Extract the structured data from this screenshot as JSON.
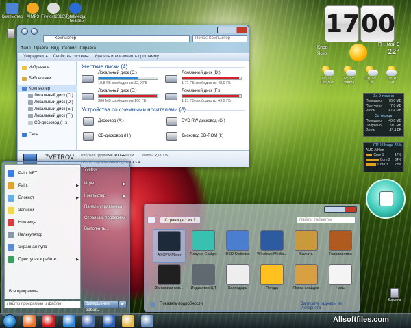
{
  "desktop_icons": [
    {
      "label": "Компьютер",
      "color": "#4d84d8"
    },
    {
      "label": "AIMP3",
      "color": "#f5a623"
    },
    {
      "label": "Firefox(2010)",
      "color": "#dddddd"
    },
    {
      "label": "TotalMedia Theatre5",
      "color": "#2b6bd6"
    }
  ],
  "explorer": {
    "address": "Компьютер",
    "search_placeholder": "Поиск: Компьютер",
    "menu": [
      "Файл",
      "Правка",
      "Вид",
      "Сервис",
      "Справка"
    ],
    "commands": [
      "Упорядочить",
      "Свойства системы",
      "Удалить или изменить программу"
    ],
    "nav": [
      {
        "label": "Избранное",
        "icon": "star-icon",
        "sub": false,
        "hl": false
      },
      {
        "label": "Библиотеки",
        "icon": "library-icon",
        "sub": false,
        "hl": false
      },
      {
        "label": "Компьютер",
        "icon": "computer-icon",
        "sub": false,
        "hl": true
      },
      {
        "label": "Локальный диск (C:)",
        "icon": "drive-icon",
        "sub": true,
        "hl": false
      },
      {
        "label": "Локальный диск (D:)",
        "icon": "drive-icon",
        "sub": true,
        "hl": false
      },
      {
        "label": "Локальный диск (E:)",
        "icon": "drive-icon",
        "sub": true,
        "hl": false
      },
      {
        "label": "Локальный диск (F:)",
        "icon": "drive-icon",
        "sub": true,
        "hl": false
      },
      {
        "label": "CD-дисковод (H:)",
        "icon": "cd-drive-icon",
        "sub": true,
        "hl": false
      },
      {
        "label": "Сеть",
        "icon": "network-icon",
        "sub": false,
        "hl": false
      }
    ],
    "group_hdd": "Жесткие диски (4)",
    "group_removable": "Устройства со съемными носителями (4)",
    "drives": [
      {
        "name": "Локальный диск (C:)",
        "free": "10,8 ГБ свободно из 32,9 ГБ",
        "used_fraction": 0.67,
        "color": "#2b88d8"
      },
      {
        "name": "Локальный диск (D:)",
        "free": "1,71 ГБ свободно из 48,9 ГБ",
        "used_fraction": 0.96,
        "color": "#d9202a"
      },
      {
        "name": "Локальный диск (E:)",
        "free": "306 МБ свободно из 100 ГБ",
        "used_fraction": 0.99,
        "color": "#d9202a"
      },
      {
        "name": "Локальный диск (F:)",
        "free": "1,21 ГБ свободно из 49,9 ГБ",
        "used_fraction": 0.97,
        "color": "#d9202a"
      }
    ],
    "removable": [
      "Дисковод (A:)",
      "DVD RW дисковод (G:)",
      "CD-дисковод (H:)",
      "Дисковод BD-ROM (I:)"
    ],
    "details": {
      "name": "7VETROV",
      "wg_label": "Рабочая группа:",
      "wg": "WORKGROUP",
      "mem_label": "Память:",
      "mem": "2,00 ГБ",
      "cpu_label": "Процессор:",
      "cpu": "AMD Athlon(tm) II X3 4..."
    }
  },
  "start_menu": {
    "programs": [
      {
        "label": "Paint.NET",
        "arrow": false,
        "color": "#3d7de0"
      },
      {
        "label": "Paint",
        "arrow": true,
        "color": "#e0a030"
      },
      {
        "label": "Блокнот",
        "arrow": true,
        "color": "#6ab0e8"
      },
      {
        "label": "Записки",
        "arrow": false,
        "color": "#f0d84a"
      },
      {
        "label": "Ножницы",
        "arrow": false,
        "color": "#d04040"
      },
      {
        "label": "Калькулятор",
        "arrow": false,
        "color": "#8899aa"
      },
      {
        "label": "Экранная лупа",
        "arrow": false,
        "color": "#5a8ad8"
      },
      {
        "label": "Приступая к работе",
        "arrow": true,
        "color": "#3aa060"
      }
    ],
    "all_programs": "Все программы",
    "right": [
      "7vetrov",
      "Игры",
      "Компьютер",
      "Панель управления",
      "Справка и поддержка",
      "Выполнить..."
    ],
    "search_placeholder": "Найти программы и файлы",
    "shutdown": "Завершение работы",
    "shutdown_arrow": "▶"
  },
  "gallery": {
    "page": "Страница 1 из 1",
    "search_placeholder": "Найти гаджеты",
    "tiles": [
      {
        "label": "All CPU Meter",
        "color": "#1d2a3a",
        "sel": true
      },
      {
        "label": "Recycle Gadget",
        "color": "#38c0b0",
        "sel": false
      },
      {
        "label": "DSD Statistics",
        "color": "#4a7fd0",
        "sel": false
      },
      {
        "label": "Windows Media...",
        "color": "#2d5ba0",
        "sel": false
      },
      {
        "label": "Валюта",
        "color": "#c89a3c",
        "sel": false
      },
      {
        "label": "Головоломка",
        "color": "#b05a20",
        "sel": false
      },
      {
        "label": "Заголовки нов...",
        "color": "#202020",
        "sel": false
      },
      {
        "label": "Индикатор ЦП",
        "color": "#606870",
        "sel": false
      },
      {
        "label": "Календарь",
        "color": "#eeeeee",
        "sel": false
      },
      {
        "label": "Погода",
        "color": "#ffc020",
        "sel": false
      },
      {
        "label": "Показ слайдов",
        "color": "#d8a040",
        "sel": false
      },
      {
        "label": "Часы",
        "color": "#f4f4f4",
        "sel": false
      }
    ],
    "details": "Показать подробности",
    "link": "Загрузить гаджеты из Интернета"
  },
  "clock": {
    "hours": "17",
    "minutes": "00"
  },
  "weather": {
    "city": "Киев",
    "condition": "Ясно",
    "date": "Пн, май 9",
    "temp": "22°",
    "forecast": [
      {
        "temps": "22° 10°",
        "day": "Сегодня"
      },
      {
        "temps": "22° 12°",
        "day": "Завтра"
      },
      {
        "temps": "19° 12°",
        "day": "Ср"
      },
      {
        "temps": "20° 11°",
        "day": "Чт"
      }
    ]
  },
  "info_panel": {
    "date": "За 9 травня",
    "rows": [
      [
        "Передано",
        "70,0 MB"
      ],
      [
        "Получено",
        "7,0 MB"
      ],
      [
        "Разом",
        "47,4 MB"
      ]
    ],
    "month": "За місяць",
    "rows2": [
      [
        "Передано",
        "40,0 MB"
      ],
      [
        "Получено",
        "9,0 MB"
      ],
      [
        "Разом",
        "43,4 FB"
      ]
    ]
  },
  "cpu_panel": {
    "title": "CPU Usage",
    "value": "35%",
    "cpu": "AMD Athlon",
    "cores": [
      [
        "Core 1",
        "17%"
      ],
      [
        "Core 2",
        "34%"
      ],
      [
        "Core 3",
        "28%"
      ]
    ]
  },
  "recycle_bin": "Корзина",
  "watermark": "Allsoftfiles.com",
  "taskbar_icons": [
    {
      "name": "firefox-icon",
      "color": "#e8702a"
    },
    {
      "name": "opera-icon",
      "color": "#d01a1a"
    },
    {
      "name": "internet-explorer-icon",
      "color": "#2f86d8"
    },
    {
      "name": "save-icon",
      "color": "#4a6fb0"
    },
    {
      "name": "word-icon",
      "color": "#2b5fb8"
    },
    {
      "name": "explorer-folder-icon",
      "color": "#e2b84a"
    },
    {
      "name": "gadgets-icon",
      "color": "#6b8fb8"
    }
  ]
}
